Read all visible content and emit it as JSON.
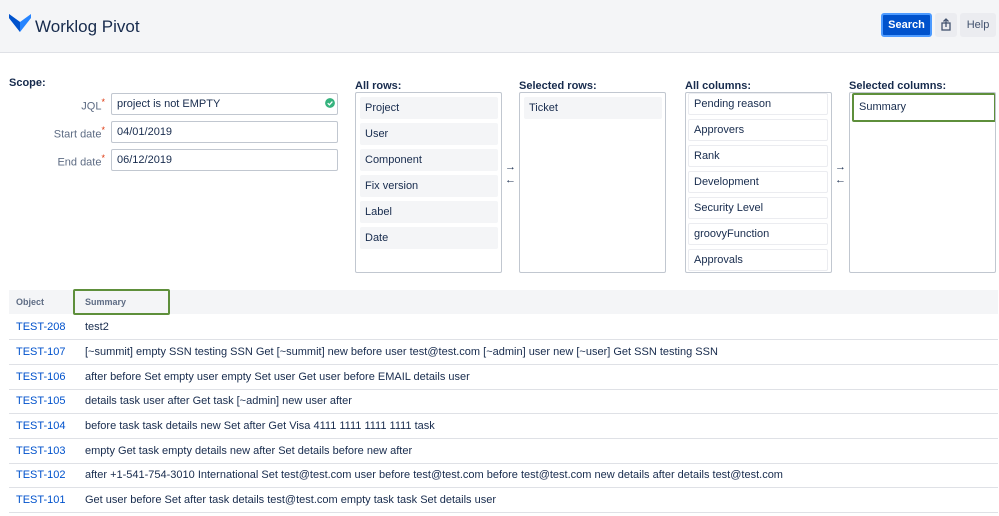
{
  "header": {
    "app_title": "Worklog Pivot",
    "search_label": "Search",
    "help_label": "Help",
    "share_icon": "share-icon",
    "logo_icon": "worklog-logo-icon",
    "accent_color": "#0052cc"
  },
  "scope": {
    "title": "Scope:",
    "jql_label": "JQL",
    "jql_value": "project is not EMPTY",
    "start_label": "Start date",
    "start_value": "04/01/2019",
    "end_label": "End date",
    "end_value": "06/12/2019"
  },
  "all_rows": {
    "title": "All rows:",
    "items": [
      "Project",
      "User",
      "Component",
      "Fix version",
      "Label",
      "Date"
    ]
  },
  "selected_rows": {
    "title": "Selected rows:",
    "items": [
      "Ticket"
    ]
  },
  "all_columns": {
    "title": "All columns:",
    "items": [
      "Pending reason",
      "Approvers",
      "Rank",
      "Development",
      "Security Level",
      "groovyFunction",
      "Approvals"
    ]
  },
  "selected_columns": {
    "title": "Selected columns:",
    "items": [
      "Summary"
    ]
  },
  "arrows": {
    "right": "→",
    "left": "←"
  },
  "table": {
    "headers": [
      "Object",
      "Summary"
    ],
    "rows": [
      {
        "key": "TEST-208",
        "summary": "test2"
      },
      {
        "key": "TEST-107",
        "summary": "[~summit] empty SSN testing SSN Get [~summit] new before user test@test.com [~admin] user new [~user] Get SSN testing SSN"
      },
      {
        "key": "TEST-106",
        "summary": "after before Set empty user empty Set user Get user before EMAIL details user"
      },
      {
        "key": "TEST-105",
        "summary": "details task user after Get task [~admin] new user after"
      },
      {
        "key": "TEST-104",
        "summary": "before task task details new Set after Get Visa 4111 1111 1111 1111 task"
      },
      {
        "key": "TEST-103",
        "summary": "empty Get task empty details new after Set details before new after"
      },
      {
        "key": "TEST-102",
        "summary": "after +1-541-754-3010 International Set test@test.com user before test@test.com before test@test.com new details after details test@test.com"
      },
      {
        "key": "TEST-101",
        "summary": "Get user before Set after task details test@test.com empty task task Set details user"
      }
    ]
  }
}
